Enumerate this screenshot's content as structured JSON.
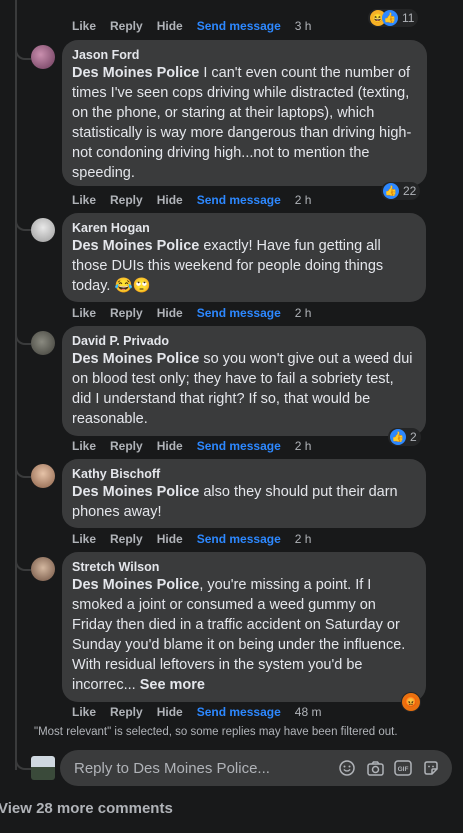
{
  "actions": {
    "like": "Like",
    "reply": "Reply",
    "hide": "Hide",
    "send": "Send message"
  },
  "top": {
    "time": "3 h",
    "reaction_count": "11"
  },
  "comments": [
    {
      "author": "Jason Ford",
      "mention": "Des Moines Police",
      "text": " I can't even count the number of times I've seen cops driving while distracted (texting, on the phone, or staring at their laptops), which statistically is way more dangerous than driving high-not condoning driving high...not to mention the speeding.",
      "time": "2 h",
      "reaction_count": "22"
    },
    {
      "author": "Karen Hogan",
      "mention": "Des Moines Police",
      "text": " exactly! Have fun getting all those DUIs this weekend for people doing things today. 😂🙄",
      "time": "2 h"
    },
    {
      "author": "David P. Privado",
      "mention": "Des Moines Police",
      "text": " so you won't give out a weed dui on blood test only; they have to fail a sobriety test, did I understand that right? If so, that would be reasonable.",
      "time": "2 h",
      "reaction_count": "2"
    },
    {
      "author": "Kathy Bischoff",
      "mention": "Des Moines Police",
      "text": " also they should put their darn phones away!",
      "time": "2 h"
    },
    {
      "author": "Stretch Wilson",
      "mention": "Des Moines Police",
      "text": ", you're missing a point. If I smoked a joint or consumed a weed gummy on Friday then died in a traffic accident on Saturday or Sunday you'd blame it on being under the influence. With residual leftovers in the system you'd be incorrec...",
      "see_more": "See more",
      "time": "48 m"
    }
  ],
  "filter_note": "\"Most relevant\" is selected, so some replies may have been filtered out.",
  "reply_placeholder": "Reply to Des Moines Police...",
  "gif_label": "GIF",
  "view_more": "View 28 more comments",
  "colors": {
    "background": "#18191a",
    "bubble": "#3a3b3c",
    "accent": "#2d88ff",
    "muted": "#b0b3b8"
  }
}
